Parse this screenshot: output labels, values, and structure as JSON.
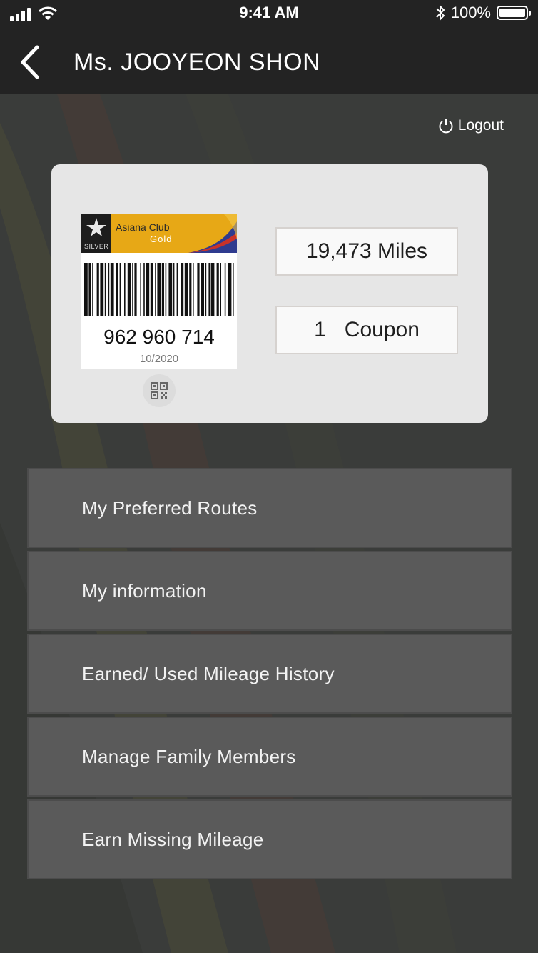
{
  "status_bar": {
    "time": "9:41 AM",
    "battery": "100%",
    "icons": [
      "signal-icon",
      "wifi-icon",
      "bluetooth-icon",
      "battery-icon"
    ]
  },
  "header": {
    "title": "Ms. JOOYEON SHON",
    "back_icon": "chevron-left-icon"
  },
  "logout": {
    "label": "Logout",
    "icon": "power-icon"
  },
  "member_card": {
    "program": "Asiana Club",
    "tier": "Gold",
    "alliance_badge": "SILVER",
    "number": "962 960 714",
    "expiry": "10/2020",
    "colors": {
      "tier_band": "#e7a816",
      "logo_bg": "#1d1d1d"
    },
    "qr_icon": "qr-code-icon"
  },
  "stats": {
    "miles": "19,473 Miles",
    "coupon_count": "1",
    "coupon_label": "Coupon"
  },
  "menu": [
    {
      "label": "My Preferred Routes"
    },
    {
      "label": "My information"
    },
    {
      "label": "Earned/ Used Mileage History"
    },
    {
      "label": "Manage Family Members"
    },
    {
      "label": "Earn Missing Mileage"
    }
  ]
}
